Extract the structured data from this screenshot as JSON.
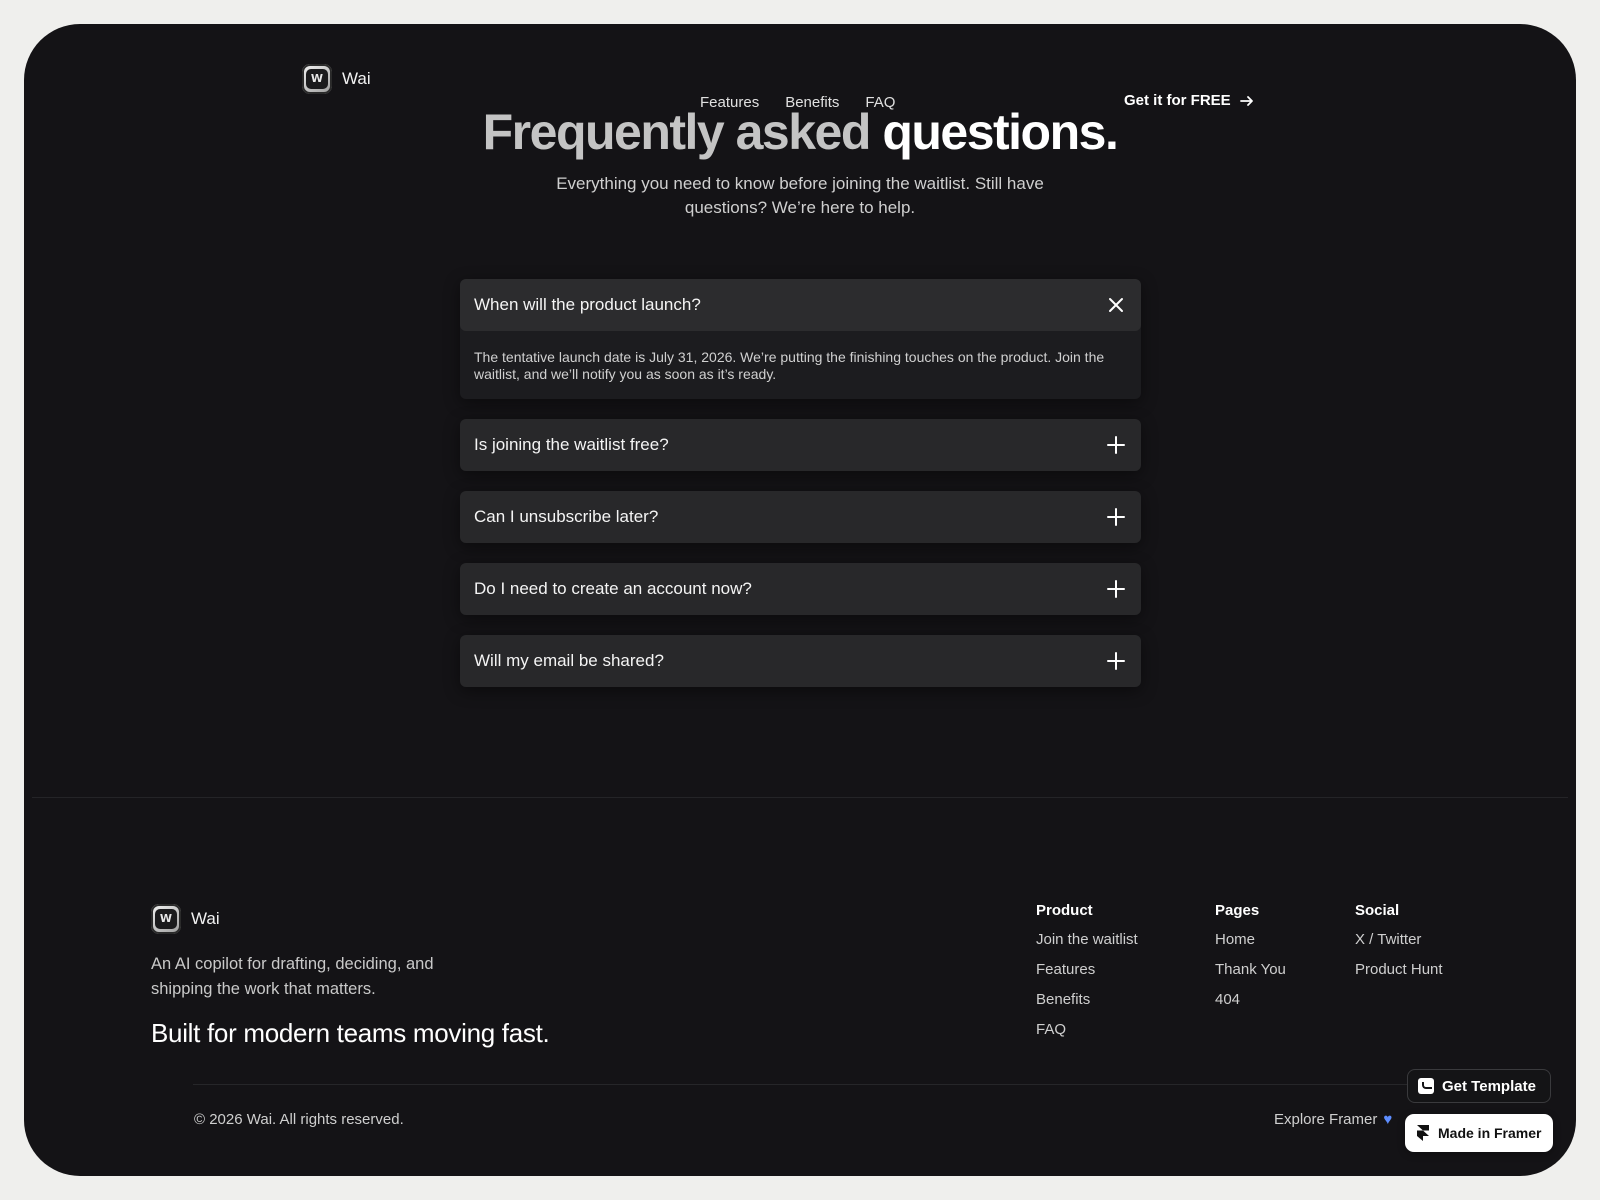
{
  "nav": {
    "brand": "Wai",
    "logo_mark": "W",
    "links": [
      "Features",
      "Benefits",
      "FAQ"
    ],
    "cta": "Get it for FREE"
  },
  "faq": {
    "title_part1": "Frequently asked",
    "title_part2": "questions.",
    "subtitle": "Everything you need to know before joining the waitlist. Still have questions? We’re here to help.",
    "items": [
      {
        "question": "When will the product launch?",
        "answer": "The tentative launch date is July 31, 2026. We’re putting the finishing touches on the product. Join the waitlist, and we’ll notify you as soon as it’s ready.",
        "expanded": true
      },
      {
        "question": "Is joining the waitlist free?",
        "expanded": false
      },
      {
        "question": "Can I unsubscribe later?",
        "expanded": false
      },
      {
        "question": "Do I need to create an account now?",
        "expanded": false
      },
      {
        "question": "Will my email be shared?",
        "expanded": false
      }
    ]
  },
  "footer": {
    "brand": "Wai",
    "description": "An AI copilot for drafting, deciding, and shipping the work that matters.",
    "tagline": "Built for modern teams moving fast.",
    "columns": [
      {
        "title": "Product",
        "links": [
          "Join the waitlist",
          "Features",
          "Benefits",
          "FAQ"
        ]
      },
      {
        "title": "Pages",
        "links": [
          "Home",
          "Thank You",
          "404"
        ]
      },
      {
        "title": "Social",
        "links": [
          "X / Twitter",
          "Product Hunt"
        ]
      }
    ],
    "copyright": "© 2026 Wai. All rights reserved.",
    "explore": "Explore Framer"
  },
  "badges": {
    "template": "Get Template",
    "framer": "Made in Framer"
  },
  "colors": {
    "background": "#141316",
    "card": "#28282a",
    "accent_heart": "#5d8dff"
  }
}
